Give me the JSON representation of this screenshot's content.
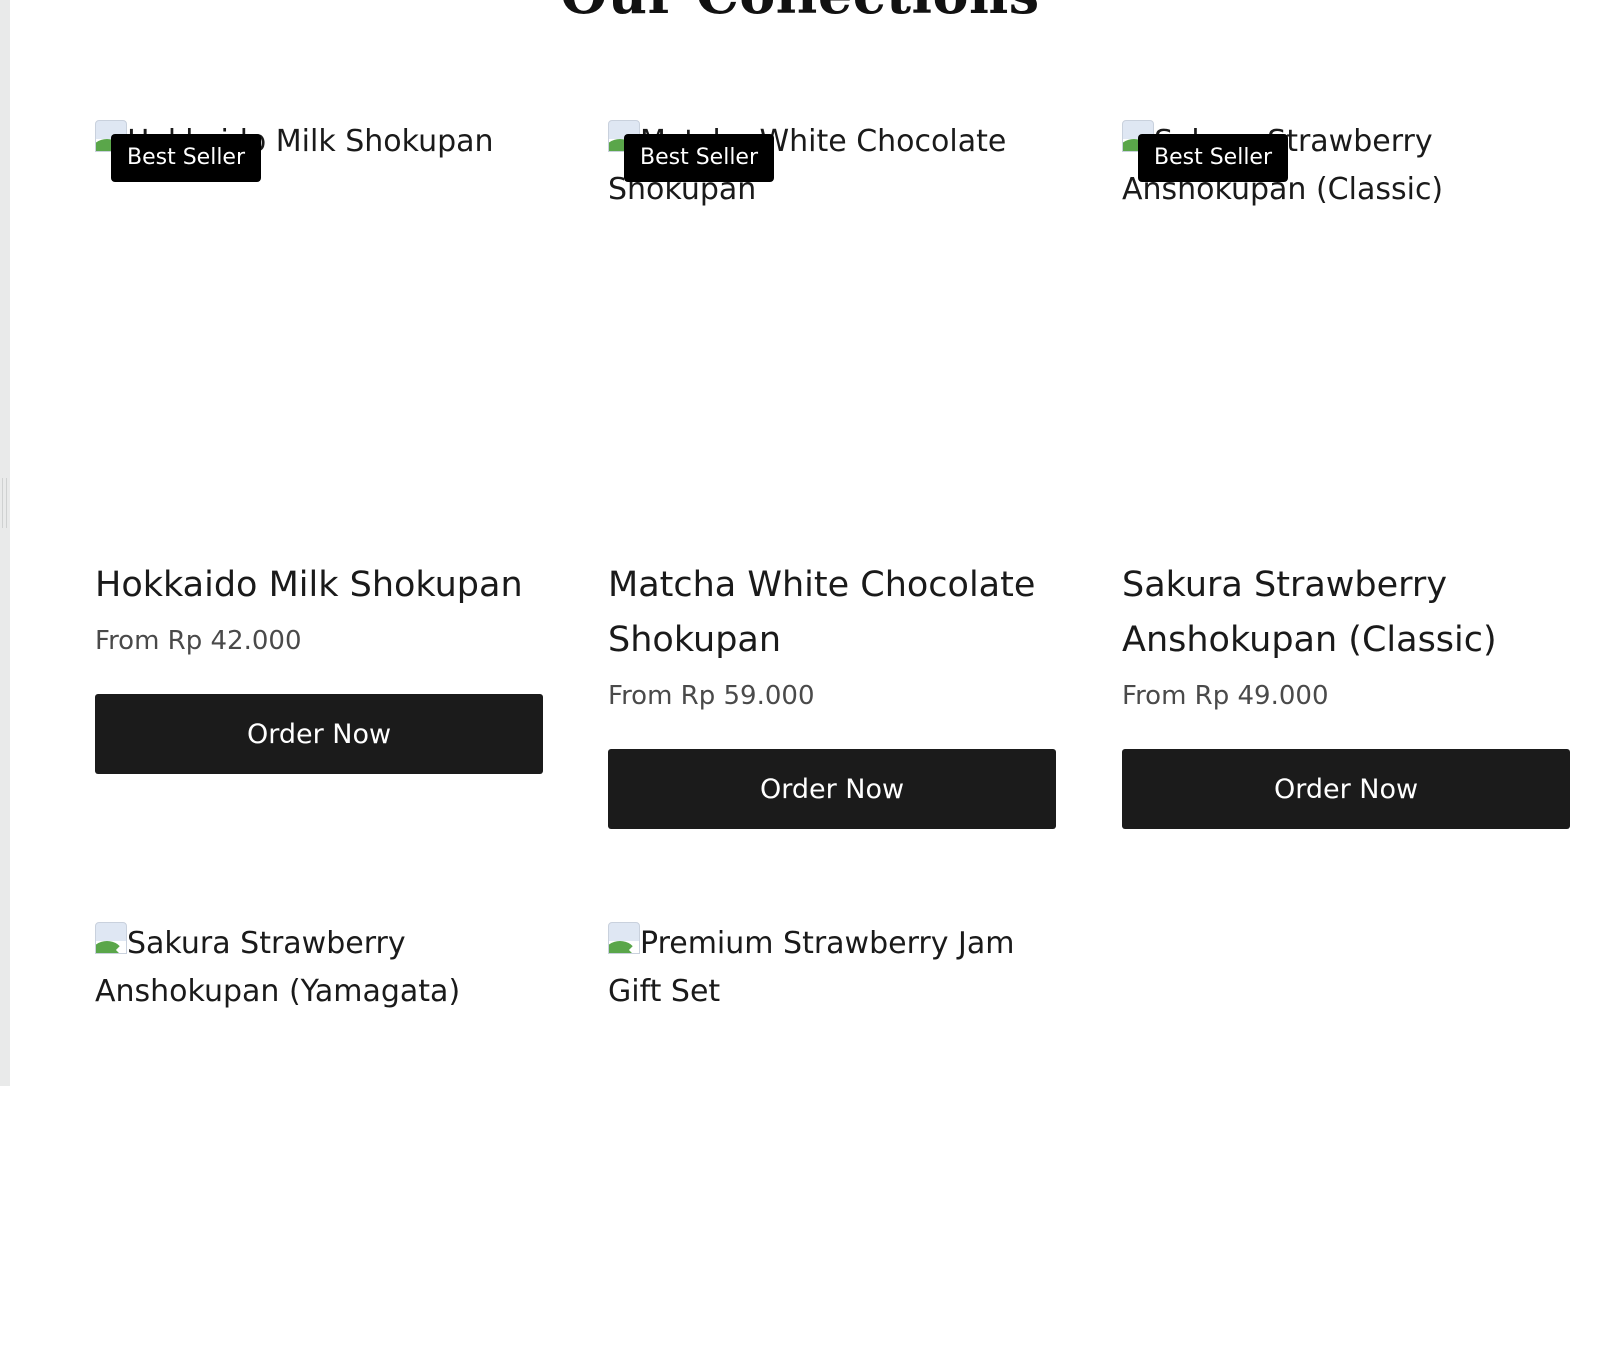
{
  "section": {
    "title": "Our Collections"
  },
  "products": [
    {
      "image_alt": "Hokkaido Milk Shokupan",
      "badge": "Best Seller",
      "name": "Hokkaido Milk Shokupan",
      "price": "From Rp 42.000",
      "button": "Order Now"
    },
    {
      "image_alt": "Matcha White Chocolate Shokupan",
      "badge": "Best Seller",
      "name": "Matcha White Chocolate Shokupan",
      "price": "From Rp 59.000",
      "button": "Order Now"
    },
    {
      "image_alt": "Sakura Strawberry Anshokupan (Classic)",
      "badge": "Best Seller",
      "name": "Sakura Strawberry Anshokupan (Classic)",
      "price": "From Rp 49.000",
      "button": "Order Now"
    },
    {
      "image_alt": "Sakura Strawberry Anshokupan (Yamagata)"
    },
    {
      "image_alt": "Premium Strawberry Jam Gift Set"
    }
  ],
  "colors": {
    "button_bg": "#1b1b1b",
    "badge_bg": "#000000",
    "price_text": "#4a4a4a",
    "gutter": "#e9eaea"
  }
}
